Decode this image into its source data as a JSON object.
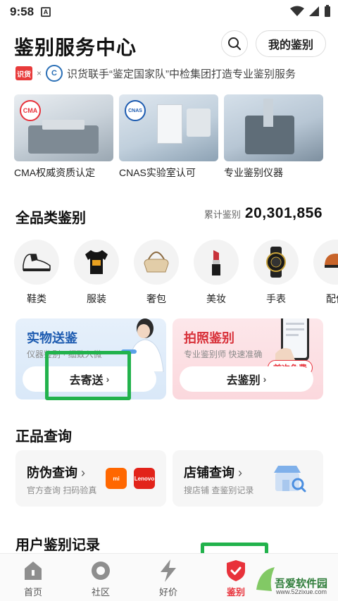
{
  "status": {
    "time": "9:58",
    "notif": "A"
  },
  "header": {
    "title": "鉴别服务中心",
    "my_label": "我的鉴别"
  },
  "partner": {
    "logo1": "识货",
    "x": "×",
    "text": "识货联手“鉴定国家队”中检集团打造专业鉴别服务"
  },
  "certs": [
    {
      "caption": "CMA权威资质认定",
      "badge": "CMA"
    },
    {
      "caption": "CNAS实验室认可",
      "badge": "CNAS"
    },
    {
      "caption": "专业鉴别仪器"
    }
  ],
  "all_category": {
    "title": "全品类鉴别",
    "total_label": "累计鉴别",
    "total_value": "20,301,856",
    "items": [
      {
        "label": "鞋类",
        "icon": "sneaker-icon"
      },
      {
        "label": "服装",
        "icon": "tshirt-icon"
      },
      {
        "label": "奢包",
        "icon": "handbag-icon"
      },
      {
        "label": "美妆",
        "icon": "lipstick-icon"
      },
      {
        "label": "手表",
        "icon": "watch-icon"
      },
      {
        "label": "配件",
        "icon": "cap-icon"
      }
    ]
  },
  "service_cards": {
    "physical": {
      "title": "实物送鉴",
      "subtitle": "仪器鉴别 · 细致入微",
      "action": "去寄送"
    },
    "photo": {
      "title": "拍照鉴别",
      "subtitle": "专业鉴别师 快速准确",
      "action": "去鉴别",
      "badge": "首次免费"
    }
  },
  "genuine_query": {
    "title": "正品查询",
    "anti_fake": {
      "title": "防伪查询",
      "subtitle": "官方查询 扫码验真",
      "brand1": "mi",
      "brand2": "Lenovo"
    },
    "store": {
      "title": "店铺查询",
      "subtitle": "搜店铺 查鉴别记录"
    }
  },
  "user_records": {
    "title": "用户鉴别记录"
  },
  "tabbar": [
    {
      "label": "首页",
      "icon": "home-icon"
    },
    {
      "label": "社区",
      "icon": "community-icon"
    },
    {
      "label": "好价",
      "icon": "lightning-icon"
    },
    {
      "label": "鉴别",
      "icon": "shield-check-icon",
      "active": true
    }
  ],
  "watermark": {
    "line1": "吾爱软件园",
    "line2": "www.52zixue.com"
  },
  "colors": {
    "accent": "#e8323b",
    "highlight": "#22b24c",
    "blue": "#1d5bb0"
  }
}
